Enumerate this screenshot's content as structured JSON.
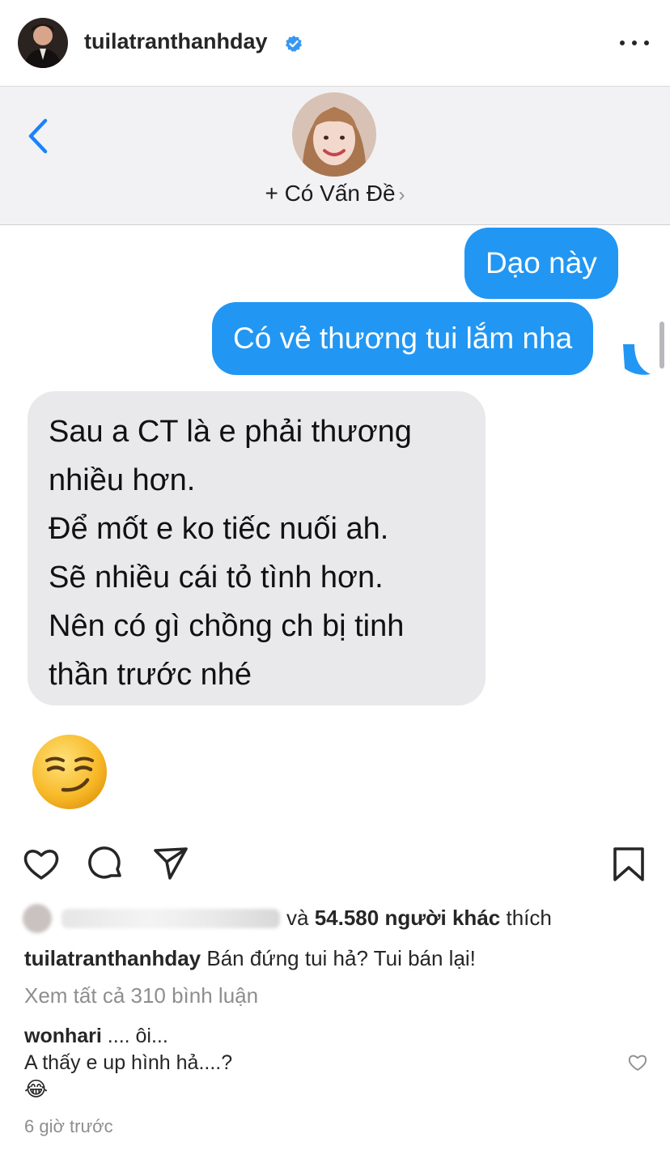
{
  "post": {
    "username": "tuilatranthanhday",
    "verified_icon": "verified-badge-icon",
    "more_icon": "more-options-icon"
  },
  "imessage": {
    "contact_name": "+ Có Vấn Đề",
    "contact_chevron": "›",
    "messages_out": [
      "Dạo này",
      "Có vẻ thương tui lắm nha"
    ],
    "message_in_lines": [
      "Sau a CT là e phải thương",
      "nhiều hơn.",
      "Để mốt e ko tiếc nuối ah.",
      "Sẽ nhiều cái tỏ tình hơn.",
      "Nên có gì chồng ch bị tinh",
      "thần trước nhé"
    ],
    "reaction_emoji": "smirking-face-emoji",
    "out_bubble_color": "#2196f3",
    "in_bubble_color": "#e9e9eb"
  },
  "actions": {
    "like": "heart-icon",
    "comment": "comment-icon",
    "share": "paper-plane-icon",
    "save": "bookmark-icon"
  },
  "likes": {
    "and": "và",
    "count": "54.580 người khác",
    "suffix": "thích"
  },
  "caption": {
    "username": "tuilatranthanhday",
    "text": "Bán đứng tui hả? Tui bán lại!"
  },
  "view_all_comments": "Xem tất cả 310 bình luận",
  "comments": [
    {
      "username": "wonhari",
      "text_line1": ".... ôi...",
      "text_line2": "A thấy e up hình hả....?",
      "emoji": "😂"
    }
  ],
  "timestamp": "6 giờ trước"
}
